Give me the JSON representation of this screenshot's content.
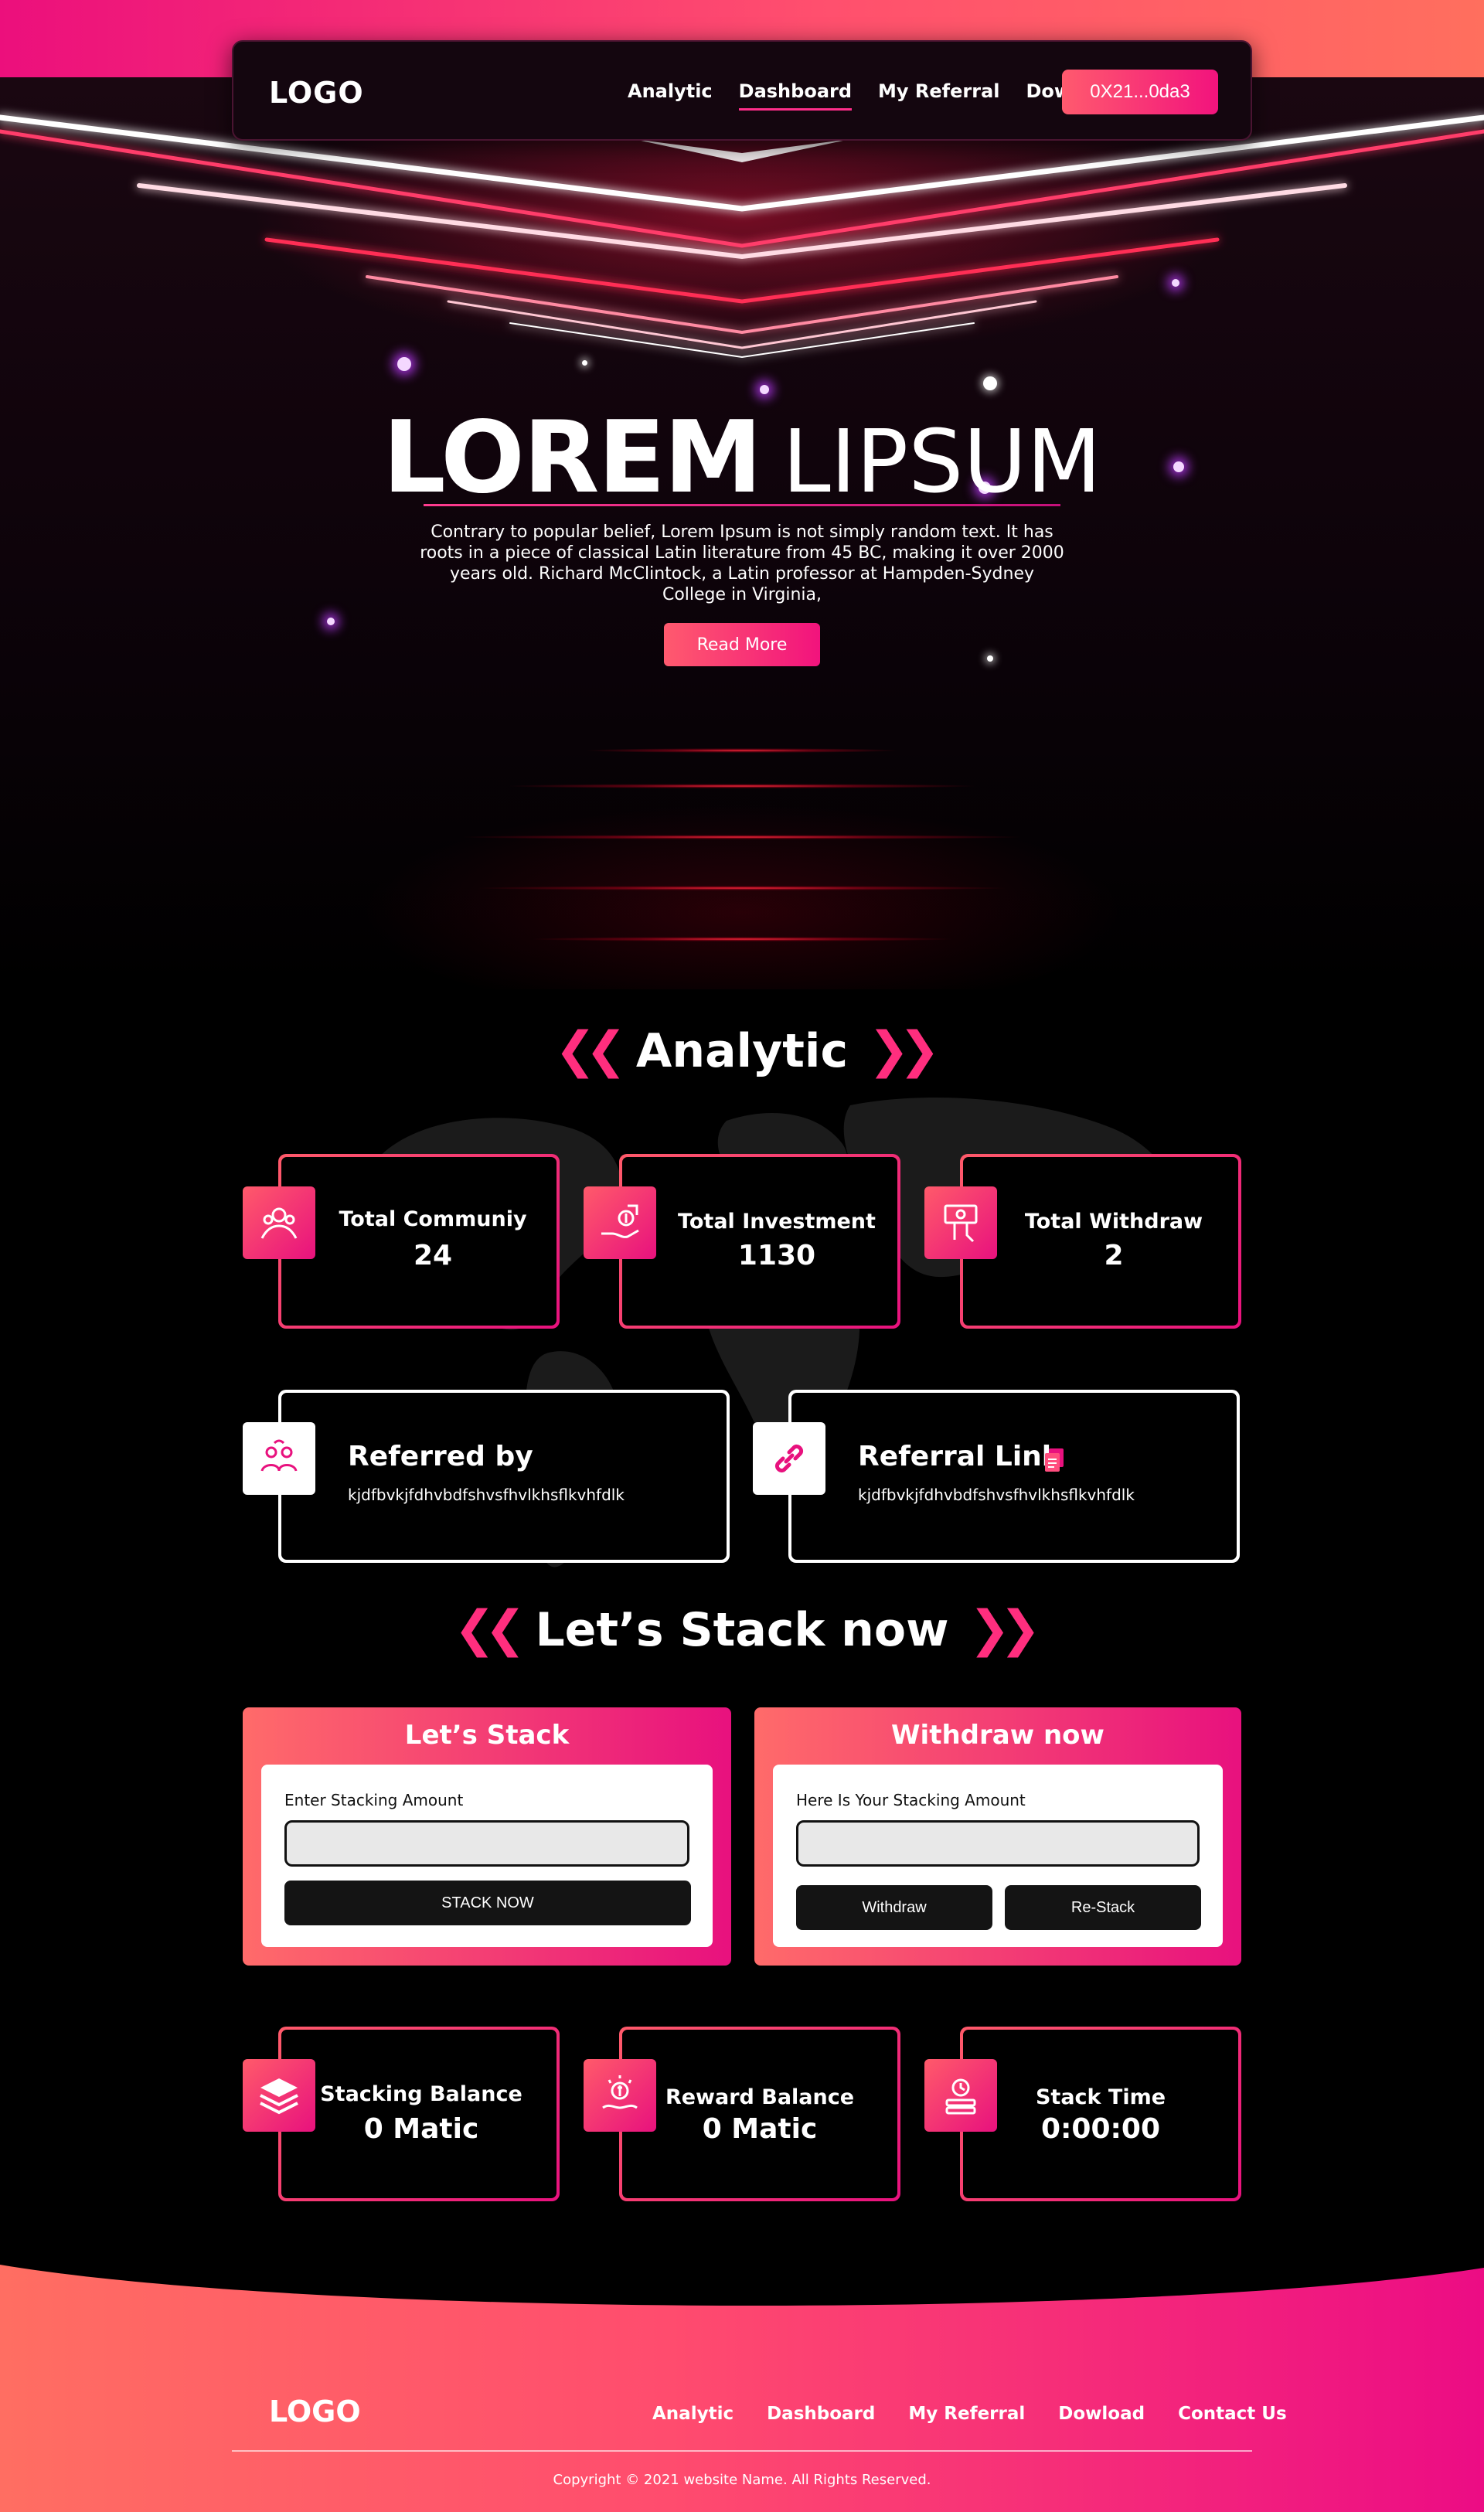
{
  "nav": {
    "logo": "LOGO",
    "links": [
      "Analytic",
      "Dashboard",
      "My Referral",
      "Dowload"
    ],
    "wallet": "0X21...0da3"
  },
  "hero": {
    "title_bold": "LOREM",
    "title_light": "LIPSUM",
    "description": "Contrary to popular belief, Lorem Ipsum is not simply random text. It has roots in a piece of classical Latin literature from 45 BC,  making it over 2000 years old. Richard McClintock, a Latin  professor at Hampden-Sydney College in Virginia,",
    "button": "Read More"
  },
  "analytic": {
    "heading": "Analytic",
    "stats": [
      {
        "label": "Total Communiy",
        "value": "24",
        "icon": "community-icon"
      },
      {
        "label": "Total Investment",
        "value": "1130",
        "icon": "investment-icon"
      },
      {
        "label": "Total Withdraw",
        "value": "2",
        "icon": "withdraw-icon"
      }
    ],
    "referred_by": {
      "title": "Referred by",
      "code": "kjdfbvkjfdhvbdfshvsfhvlkhsflkvhfdlk"
    },
    "referral_link": {
      "title": "Referral Link",
      "code": "kjdfbvkjfdhvbdfshvsfhvlkhsflkvhfdlk"
    }
  },
  "stack": {
    "heading": "Let’s Stack now",
    "stack_panel": {
      "title": "Let’s Stack",
      "label": "Enter Stacking Amount",
      "input_value": "",
      "button": "STACK NOW"
    },
    "withdraw_panel": {
      "title": "Withdraw now",
      "label": "Here Is Your Stacking Amount",
      "input_value": "",
      "withdraw_button": "Withdraw",
      "restack_button": "Re-Stack"
    },
    "balances": [
      {
        "label": "Stacking Balance",
        "value": "0 Matic",
        "icon": "layers-icon"
      },
      {
        "label": "Reward Balance",
        "value": "0 Matic",
        "icon": "reward-icon"
      },
      {
        "label": "Stack Time",
        "value": "0:00:00",
        "icon": "clock-stack-icon"
      }
    ]
  },
  "footer": {
    "logo": "LOGO",
    "links": [
      "Analytic",
      "Dashboard",
      "My Referral",
      "Dowload",
      "Contact Us"
    ],
    "copyright": "Copyright © 2021 website Name. All Rights Reserved."
  },
  "colors": {
    "accent_pink": "#e8117e",
    "accent_coral": "#ff5a6a",
    "background": "#000000"
  }
}
